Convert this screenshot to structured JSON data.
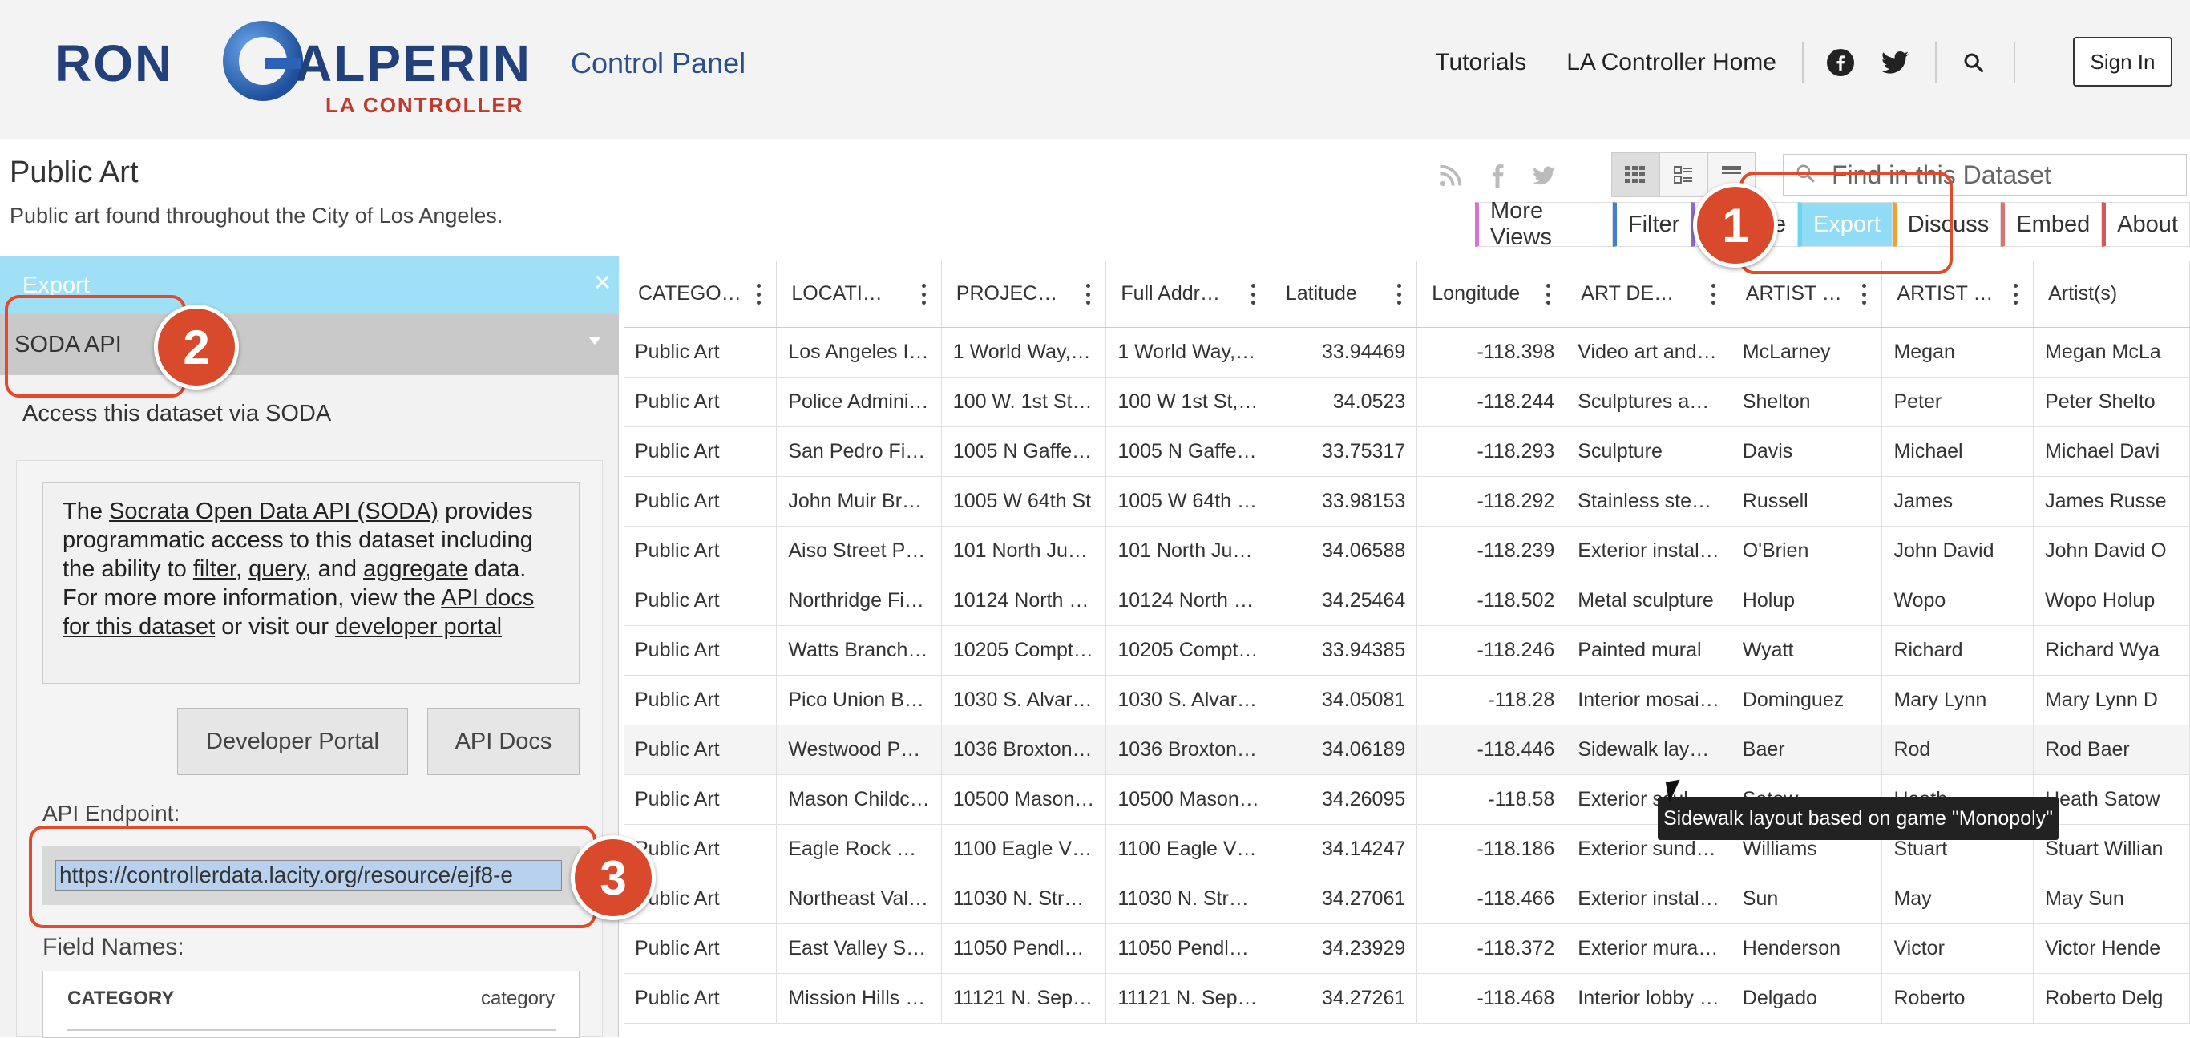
{
  "header": {
    "logo_name_1": "RON",
    "logo_name_2": "ALPERIN",
    "logo_subtitle": "LA CONTROLLER",
    "app_title": "Control Panel",
    "nav": [
      "Tutorials",
      "LA Controller Home"
    ],
    "sign_in": "Sign In"
  },
  "dataset": {
    "title": "Public Art",
    "description": "Public art found throughout the City of Los Angeles.",
    "search_placeholder": "Find in this Dataset",
    "toolbar": [
      "More Views",
      "Filter",
      "ze",
      "Export",
      "Discuss",
      "Embed",
      "About"
    ]
  },
  "export_panel": {
    "title": "Export",
    "api_select": "SODA API",
    "access_text": "Access this dataset via SODA",
    "info": {
      "t1": "The ",
      "l1": "Socrata Open Data API (SODA)",
      "t2": " provides programmatic access to this dataset including the ability to ",
      "l2": "filter",
      "t3": ", ",
      "l3": "query",
      "t4": ", and ",
      "l4": "aggregate",
      "t5": " data. For more more information, view the ",
      "l5": "API docs for this dataset",
      "t6": " or visit our ",
      "l6": "developer portal"
    },
    "developer_portal_btn": "Developer Portal",
    "api_docs_btn": "API Docs",
    "endpoint_label": "API Endpoint:",
    "endpoint_url": "https://controllerdata.lacity.org/resource/ejf8-e",
    "field_names_label": "Field Names:",
    "fields": [
      {
        "name": "CATEGORY",
        "key": "category"
      }
    ]
  },
  "grid": {
    "columns": [
      "CATEGO…",
      "LOCATI…",
      "PROJEC…",
      "Full Addr…",
      "Latitude",
      "Longitude",
      "ART DE…",
      "ARTIST …",
      "ARTIST …",
      "Artist(s)"
    ],
    "rows": [
      [
        "Public Art",
        "Los Angeles I…",
        "1 World Way,…",
        "1 World Way,…",
        "33.94469",
        "-118.398",
        "Video art and…",
        "McLarney",
        "Megan",
        "Megan McLa"
      ],
      [
        "Public Art",
        "Police Admini…",
        "100 W. 1st St…",
        "100 W 1st St,…",
        "34.0523",
        "-118.244",
        "Sculptures a…",
        "Shelton",
        "Peter",
        "Peter Shelto"
      ],
      [
        "Public Art",
        "San Pedro Fi…",
        "1005 N Gaffe…",
        "1005 N Gaffe…",
        "33.75317",
        "-118.293",
        "Sculpture",
        "Davis",
        "Michael",
        "Michael Davi"
      ],
      [
        "Public Art",
        "John Muir Br…",
        "1005 W 64th St",
        "1005 W 64th …",
        "33.98153",
        "-118.292",
        "Stainless ste…",
        "Russell",
        "James",
        "James Russe"
      ],
      [
        "Public Art",
        "Aiso Street P…",
        "101 North Ju…",
        "101 North Ju…",
        "34.06588",
        "-118.239",
        "Exterior instal…",
        "O'Brien",
        "John David",
        "John David O"
      ],
      [
        "Public Art",
        "Northridge Fi…",
        "10124 North …",
        "10124 North …",
        "34.25464",
        "-118.502",
        "Metal sculpture",
        "Holup",
        "Wopo",
        "Wopo Holup"
      ],
      [
        "Public Art",
        "Watts Branch…",
        "10205 Compt…",
        "10205 Compt…",
        "33.94385",
        "-118.246",
        "Painted mural",
        "Wyatt",
        "Richard",
        "Richard Wya"
      ],
      [
        "Public Art",
        "Pico Union B…",
        "1030 S. Alvar…",
        "1030 S. Alvar…",
        "34.05081",
        "-118.28",
        "Interior mosai…",
        "Dominguez",
        "Mary Lynn",
        "Mary Lynn D"
      ],
      [
        "Public Art",
        "Westwood P…",
        "1036 Broxton…",
        "1036 Broxton…",
        "34.06189",
        "-118.446",
        "Sidewalk lay…",
        "Baer",
        "Rod",
        "Rod Baer"
      ],
      [
        "Public Art",
        "Mason Childc…",
        "10500 Mason…",
        "10500 Mason…",
        "34.26095",
        "-118.58",
        "Exterior scul…",
        "Satow",
        "Heath",
        "Heath Satow"
      ],
      [
        "Public Art",
        "Eagle Rock …",
        "1100 Eagle V…",
        "1100 Eagle V…",
        "34.14247",
        "-118.186",
        "Exterior sund…",
        "Williams",
        "Stuart",
        "Stuart Willian"
      ],
      [
        "Public Art",
        "Northeast Val…",
        "11030 N. Str…",
        "11030 N. Str…",
        "34.27061",
        "-118.466",
        "Exterior instal…",
        "Sun",
        "May",
        "May Sun"
      ],
      [
        "Public Art",
        "East Valley S…",
        "11050 Pendl…",
        "11050 Pendl…",
        "34.23929",
        "-118.372",
        "Exterior mura…",
        "Henderson",
        "Victor",
        "Victor Hende"
      ],
      [
        "Public Art",
        "Mission Hills …",
        "11121 N. Sep…",
        "11121 N. Sep…",
        "34.27261",
        "-118.468",
        "Interior lobby …",
        "Delgado",
        "Roberto",
        "Roberto Delg"
      ]
    ],
    "hovered_row": 8,
    "tooltip": "Sidewalk layout based on game \"Monopoly\""
  },
  "annotations": [
    "1",
    "2",
    "3"
  ],
  "colors": {
    "brand_blue": "#22407a",
    "brand_red": "#c0392b",
    "export_accent": "#90dcf7",
    "annotation_red": "#e24a2a"
  }
}
